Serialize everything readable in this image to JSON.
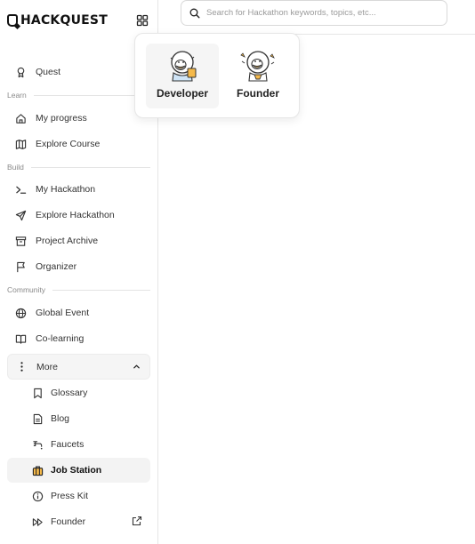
{
  "brand": {
    "name": "HACKQUEST"
  },
  "search": {
    "placeholder": "Search for Hackathon keywords, topics, etc..."
  },
  "sections": {
    "learn": "Learn",
    "build": "Build",
    "community": "Community"
  },
  "nav": {
    "quest": "Quest",
    "my_progress": "My progress",
    "explore_course": "Explore Course",
    "my_hackathon": "My Hackathon",
    "explore_hackathon": "Explore Hackathon",
    "project_archive": "Project Archive",
    "organizer": "Organizer",
    "global_event": "Global Event",
    "co_learning": "Co-learning",
    "more": "More",
    "glossary": "Glossary",
    "blog": "Blog",
    "faucets": "Faucets",
    "job_station": "Job Station",
    "press_kit": "Press Kit",
    "founder": "Founder"
  },
  "apps_menu": {
    "developer": "Developer",
    "founder": "Founder"
  },
  "icons": {
    "quest": "trophy-icon",
    "my_progress": "home-icon",
    "explore_course": "map-icon",
    "my_hackathon": "terminal-icon",
    "explore_hackathon": "send-icon",
    "project_archive": "archive-icon",
    "organizer": "flag-icon",
    "global_event": "globe-icon",
    "co_learning": "book-open-icon",
    "more": "more-vertical-icon",
    "glossary": "bookmark-icon",
    "blog": "file-icon",
    "faucets": "faucet-icon",
    "job_station": "briefcase-icon",
    "press_kit": "info-icon",
    "founder": "fast-forward-icon"
  },
  "colors": {
    "accent": "#111111",
    "active_bg": "#f3f3f3",
    "border": "#e6e6e6",
    "briefcase": "#f5b94a"
  }
}
